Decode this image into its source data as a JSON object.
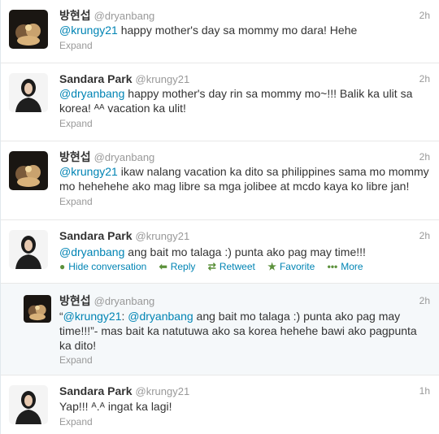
{
  "tweets": [
    {
      "fullname": "방현섭",
      "username": "@dryanbang",
      "time": "2h",
      "mention": "@krungy21",
      "text": " happy mother's day sa mommy mo dara! Hehe",
      "expand": "Expand",
      "avatar": "avatar-dryanbang"
    },
    {
      "fullname": "Sandara Park",
      "username": "@krungy21",
      "time": "2h",
      "mention": "@dryanbang",
      "text": " happy mother's day rin sa mommy mo~!!! Balik ka ulit sa korea! ᴬᴬ vacation ka ulit!",
      "expand": "Expand",
      "avatar": "avatar-krungy21"
    },
    {
      "fullname": "방현섭",
      "username": "@dryanbang",
      "time": "2h",
      "mention": "@krungy21",
      "text": " ikaw nalang vacation ka dito sa philippines sama mo mommy mo hehehehe ako mag libre sa mga jolibee at mcdo kaya ko libre jan!",
      "expand": "Expand",
      "avatar": "avatar-dryanbang"
    },
    {
      "fullname": "Sandara Park",
      "username": "@krungy21",
      "time": "2h",
      "mention": "@dryanbang",
      "text": " ang bait mo talaga :) punta ako pag may time!!!",
      "actions": {
        "hide": "Hide conversation",
        "reply": "Reply",
        "retweet": "Retweet",
        "favorite": "Favorite",
        "more": "More"
      },
      "avatar": "avatar-krungy21"
    },
    {
      "fullname": "방현섭",
      "username": "@dryanbang",
      "time": "2h",
      "quote_open": "“",
      "mention1": "@krungy21",
      "colon": ": ",
      "mention2": "@dryanbang",
      "text": " ang bait mo talaga :) punta ako pag may time!!!”- mas bait ka natutuwa ako sa korea hehehe bawi ako pagpunta ka dito!",
      "expand": "Expand",
      "avatar": "avatar-dryanbang"
    },
    {
      "fullname": "Sandara Park",
      "username": "@krungy21",
      "time": "1h",
      "text": "Yap!!! ᴬ.ᴬ ingat ka lagi!",
      "expand": "Expand",
      "avatar": "avatar-krungy21"
    }
  ],
  "colors": {
    "link": "#0084b4",
    "muted": "#999999",
    "reply_bg": "#f5f8fa"
  }
}
